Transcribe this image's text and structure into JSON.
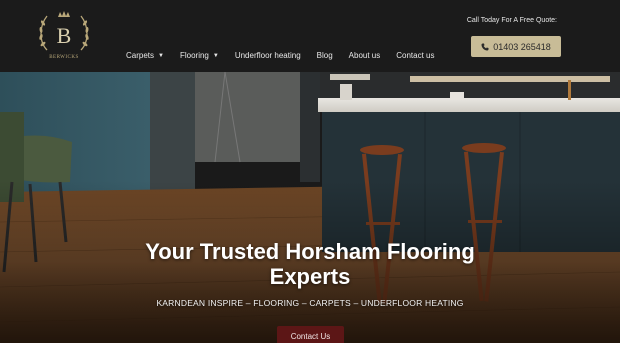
{
  "brand": {
    "logo_letter": "B",
    "logo_text": "BERWICKS",
    "accent_gold": "#c8bc97",
    "button_red": "#5c1616"
  },
  "nav": {
    "items": [
      {
        "label": "Carpets",
        "has_dropdown": true
      },
      {
        "label": "Flooring",
        "has_dropdown": true
      },
      {
        "label": "Underfloor heating",
        "has_dropdown": false
      },
      {
        "label": "Blog",
        "has_dropdown": false
      },
      {
        "label": "About us",
        "has_dropdown": false
      },
      {
        "label": "Contact us",
        "has_dropdown": false
      }
    ],
    "caret_icon": "chevron-down-icon"
  },
  "header": {
    "quote_label": "Call Today For A Free Quote:",
    "phone": "01403 265418",
    "phone_icon": "phone-icon"
  },
  "hero": {
    "title_line1": "Your Trusted Horsham Flooring",
    "title_line2": "Experts",
    "subtitle": "KARNDEAN INSPIRE – FLOORING – CARPETS – UNDERFLOOR HEATING",
    "cta_label": "Contact Us"
  }
}
